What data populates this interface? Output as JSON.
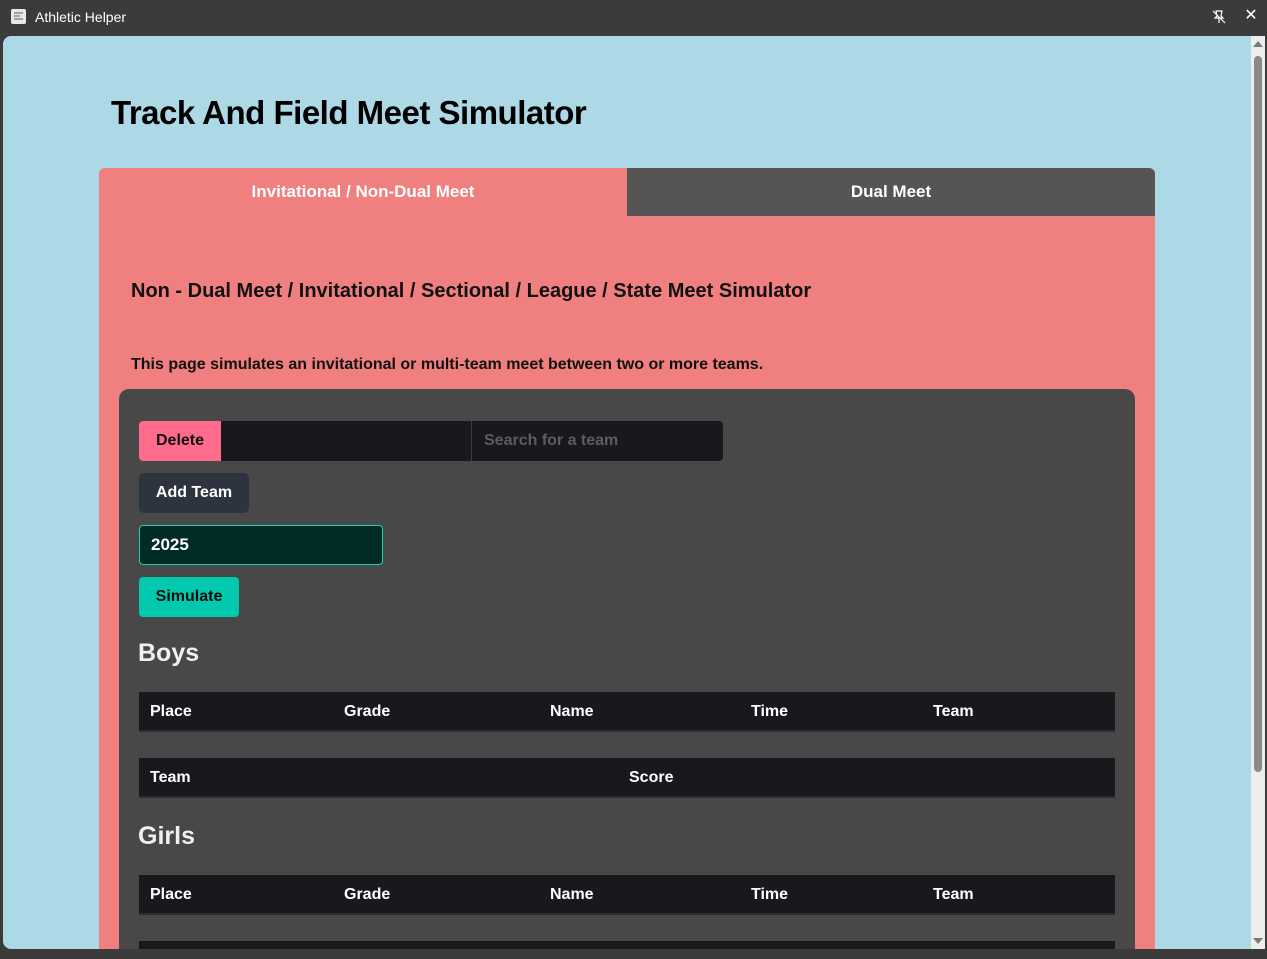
{
  "window": {
    "title": "Athletic Helper",
    "icons": {
      "app": "app-icon",
      "pin": "unpin-icon",
      "close": "close-icon"
    }
  },
  "page": {
    "title": "Track And Field Meet Simulator"
  },
  "tabs": [
    {
      "label": "Invitational / Non-Dual Meet",
      "active": true
    },
    {
      "label": "Dual Meet",
      "active": false
    }
  ],
  "panel": {
    "subtitle": "Non - Dual Meet / Invitational / Sectional / League / State Meet Simulator",
    "description": "This page simulates an invitational or multi-team meet between two or more teams."
  },
  "controls": {
    "delete_label": "Delete",
    "team_select_value": "",
    "search_placeholder": "Search for a team",
    "add_team_label": "Add Team",
    "year_value": "2025",
    "simulate_label": "Simulate"
  },
  "boys": {
    "heading": "Boys",
    "results_columns": [
      "Place",
      "Grade",
      "Name",
      "Time",
      "Team"
    ],
    "score_columns": [
      "Team",
      "Score"
    ]
  },
  "girls": {
    "heading": "Girls",
    "results_columns": [
      "Place",
      "Grade",
      "Name",
      "Time",
      "Team"
    ]
  },
  "colors": {
    "background": "#add8e6",
    "panel": "#f08080",
    "card": "#484848",
    "delete": "#ff6b8a",
    "simulate": "#00c9ad",
    "inactive_tab": "#555555"
  }
}
